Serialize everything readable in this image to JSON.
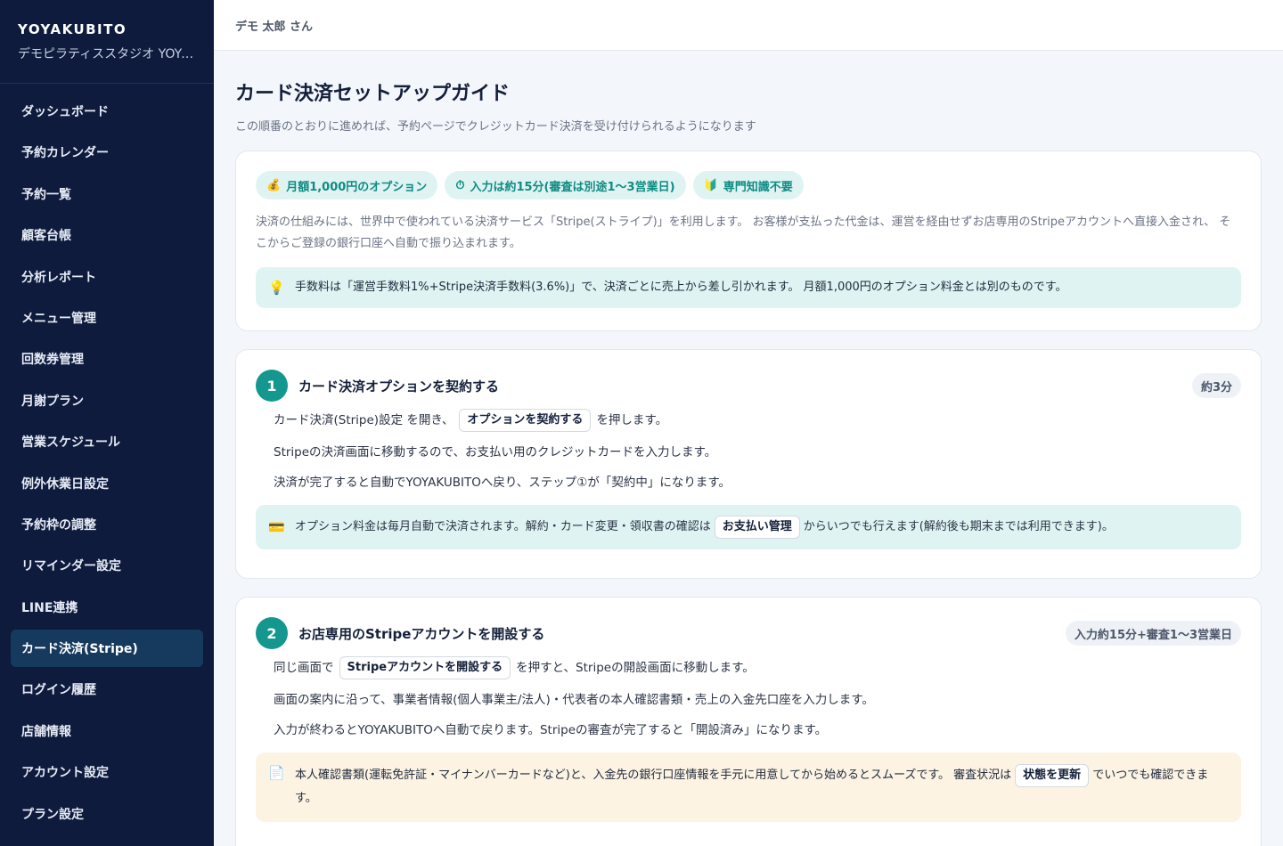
{
  "sidebar": {
    "brand": "YOYAKUBITO",
    "studio": "デモピラティススタジオ YOYAKUBITO",
    "items": [
      {
        "label": "ダッシュボード"
      },
      {
        "label": "予約カレンダー"
      },
      {
        "label": "予約一覧"
      },
      {
        "label": "顧客台帳"
      },
      {
        "label": "分析レポート"
      },
      {
        "label": "メニュー管理"
      },
      {
        "label": "回数券管理"
      },
      {
        "label": "月謝プラン"
      },
      {
        "label": "営業スケジュール"
      },
      {
        "label": "例外休業日設定"
      },
      {
        "label": "予約枠の調整"
      },
      {
        "label": "リマインダー設定"
      },
      {
        "label": "LINE連携"
      },
      {
        "label": "カード決済(Stripe)"
      },
      {
        "label": "ログイン履歴"
      },
      {
        "label": "店舗情報"
      },
      {
        "label": "アカウント設定"
      },
      {
        "label": "プラン設定"
      }
    ],
    "active_index": 13
  },
  "header": {
    "user": "デモ 太郎 さん"
  },
  "page": {
    "title": "カード決済セットアップガイド",
    "subtitle": "この順番のとおりに進めれば、予約ページでクレジットカード決済を受け付けられるようになります"
  },
  "intro": {
    "chips": [
      {
        "icon": "💰",
        "icon_name": "money-bag-icon",
        "label": "月額1,000円のオプション"
      },
      {
        "icon": "⏱",
        "icon_name": "stopwatch-icon",
        "label": "入力は約15分(審査は別途1〜3営業日)"
      },
      {
        "icon": "🔰",
        "icon_name": "beginner-mark-icon",
        "label": "専門知識不要"
      }
    ],
    "text": "決済の仕組みには、世界中で使われている決済サービス「Stripe(ストライプ)」を利用します。 お客様が支払った代金は、運営を経由せずお店専用のStripeアカウントへ直接入金され、 そこからご登録の銀行口座へ自動で振り込まれます。",
    "note": "手数料は「運営手数料1%+Stripe決済手数料(3.6%)」で、決済ごとに売上から差し引かれます。 月額1,000円のオプション料金とは別のものです。"
  },
  "step1": {
    "number": "1",
    "title": "カード決済オプションを契約する",
    "time": "約3分",
    "line1_pre": "カード決済(Stripe)設定 を開き、",
    "line1_button": "オプションを契約する",
    "line1_post": "を押します。",
    "line2": "Stripeの決済画面に移動するので、お支払い用のクレジットカードを入力します。",
    "line3": "決済が完了すると自動でYOYAKUBITOへ戻り、ステップ①が「契約中」になります。",
    "note_pre": "オプション料金は毎月自動で決済されます。解約・カード変更・領収書の確認は",
    "note_button": "お支払い管理",
    "note_post": "からいつでも行えます(解約後も期末までは利用できます)。"
  },
  "step2": {
    "number": "2",
    "title": "お店専用のStripeアカウントを開設する",
    "time": "入力約15分+審査1〜3営業日",
    "line1_pre": "同じ画面で",
    "line1_button": "Stripeアカウントを開設する",
    "line1_post": "を押すと、Stripeの開設画面に移動します。",
    "line2": "画面の案内に沿って、事業者情報(個人事業主/法人)・代表者の本人確認書類・売上の入金先口座を入力します。",
    "line3": "入力が終わるとYOYAKUBITOへ自動で戻ります。Stripeの審査が完了すると「開設済み」になります。",
    "note_pre": "本人確認書類(運転免許証・マイナンバーカードなど)と、入金先の銀行口座情報を手元に用意してから始めるとスムーズです。 審査状況は",
    "note_button": "状態を更新",
    "note_post": "でいつでも確認できます。"
  },
  "colors": {
    "sidebar_bg": "#0e1b3d",
    "sidebar_active": "#163a5e",
    "accent": "#14978e",
    "chip_bg": "#dff4f2",
    "warn_bg": "#fdf3e3"
  }
}
